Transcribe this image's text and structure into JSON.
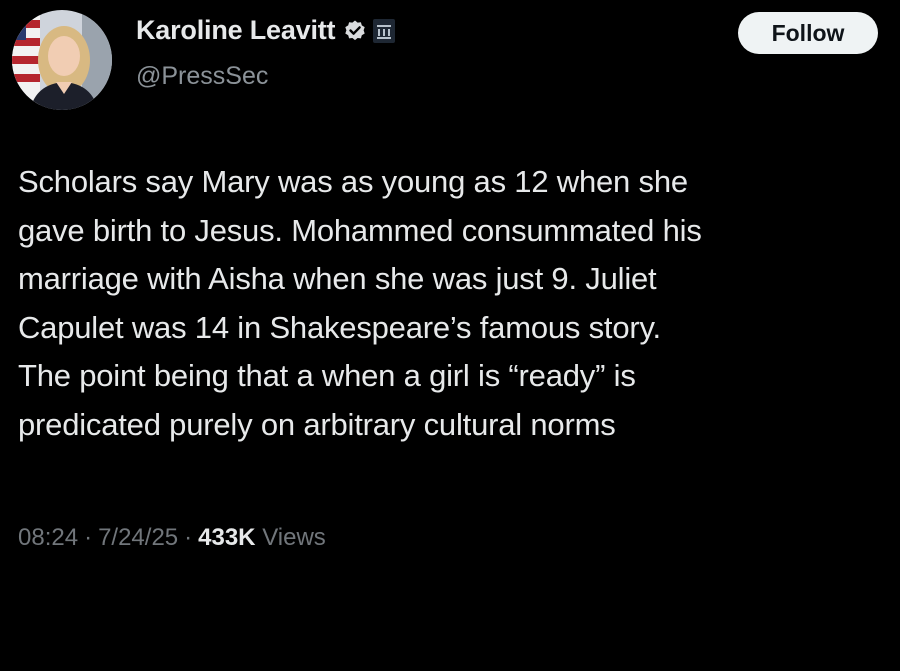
{
  "author": {
    "display_name": "Karoline Leavitt",
    "handle": "@PressSec",
    "verified_icon": "verified-badge-icon",
    "affiliation_icon": "white-house-affiliation-icon"
  },
  "follow_button": {
    "label": "Follow"
  },
  "post": {
    "lines": [
      "Scholars say Mary was as young as 12 when she",
      "gave birth to Jesus. Mohammed consummated his",
      "marriage with Aisha when she was just 9. Juliet",
      "Capulet was 14 in Shakespeare’s famous story.",
      "The point being that a when a girl is “ready” is",
      "predicated purely on arbitrary cultural norms"
    ]
  },
  "meta": {
    "time": "08:24",
    "date": "7/24/25",
    "separator": "·",
    "views_count": "433K",
    "views_label": "Views"
  },
  "colors": {
    "background": "#000000",
    "text_primary": "#e7e9ea",
    "text_secondary": "#71767b",
    "button_bg": "#eff3f4",
    "button_text": "#0f1419"
  }
}
